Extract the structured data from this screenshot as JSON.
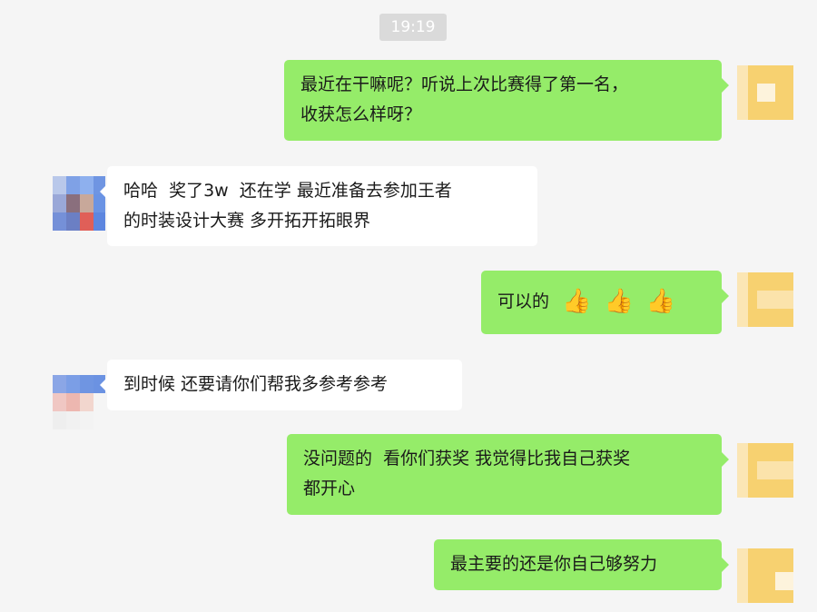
{
  "timestamp": "19:19",
  "messages": [
    {
      "side": "sent",
      "text": "最近在干嘛呢？听说上次比赛得了第一名，\n收获怎么样呀？"
    },
    {
      "side": "recv",
      "text": "哈哈  奖了3w  还在学 最近准备去参加王者\n的时装设计大赛 多开拓开拓眼界"
    },
    {
      "side": "sent",
      "text": "可以的",
      "emojis": [
        "👍",
        "👍",
        "👍"
      ]
    },
    {
      "side": "recv",
      "text": "到时候 还要请你们帮我多参考参考"
    },
    {
      "side": "sent",
      "text": "没问题的  看你们获奖 我觉得比我自己获奖\n都开心"
    },
    {
      "side": "sent",
      "text": "最主要的还是你自己够努力"
    }
  ],
  "colors": {
    "background": "#f5f5f5",
    "sent_bubble": "#95ec69",
    "recv_bubble": "#ffffff",
    "timestamp_bg": "#dadada"
  }
}
